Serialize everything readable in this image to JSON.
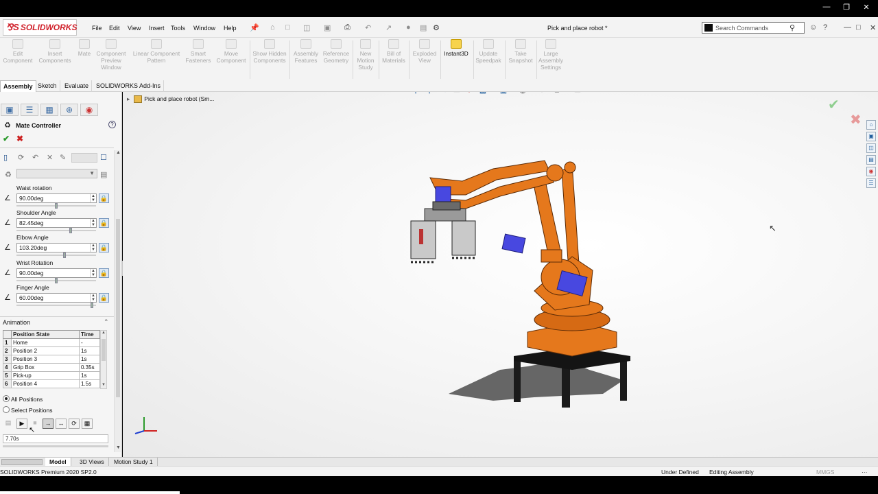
{
  "app": {
    "logo": "SOLIDWORKS",
    "document_title": "Pick and place robot *",
    "menus": [
      "File",
      "Edit",
      "View",
      "Insert",
      "Tools",
      "Window",
      "Help"
    ],
    "search_placeholder": "Search Commands"
  },
  "command_manager": {
    "buttons": [
      {
        "label": "Edit Component",
        "enabled": false
      },
      {
        "label": "Insert Components",
        "enabled": false
      },
      {
        "label": "Mate",
        "enabled": false
      },
      {
        "label": "Component Preview Window",
        "enabled": false
      },
      {
        "label": "Linear Component Pattern",
        "enabled": false
      },
      {
        "label": "Smart Fasteners",
        "enabled": false
      },
      {
        "label": "Move Component",
        "enabled": false
      },
      {
        "label": "Show Hidden Components",
        "enabled": false
      },
      {
        "label": "Assembly Features",
        "enabled": false
      },
      {
        "label": "Reference Geometry",
        "enabled": false
      },
      {
        "label": "New Motion Study",
        "enabled": false
      },
      {
        "label": "Bill of Materials",
        "enabled": false
      },
      {
        "label": "Exploded View",
        "enabled": false
      },
      {
        "label": "Instant3D",
        "enabled": true
      },
      {
        "label": "Update Speedpak",
        "enabled": false
      },
      {
        "label": "Take Snapshot",
        "enabled": false
      },
      {
        "label": "Large Assembly Settings",
        "enabled": false
      }
    ]
  },
  "tabs": [
    "Assembly",
    "Sketch",
    "Evaluate",
    "SOLIDWORKS Add-Ins"
  ],
  "active_tab": "Assembly",
  "panel": {
    "title": "Mate Controller",
    "mates": [
      {
        "label": "Waist rotation",
        "value": "90.00deg",
        "slider": 0.5
      },
      {
        "label": "Shoulder Angle",
        "value": "82.45deg",
        "slider": 0.69
      },
      {
        "label": "Elbow Angle",
        "value": "103.20deg",
        "slider": 0.61
      },
      {
        "label": "Wrist Rotation",
        "value": "90.00deg",
        "slider": 0.5
      },
      {
        "label": "Finger Angle",
        "value": "60.00deg",
        "slider": 0.96
      }
    ],
    "animation": {
      "header": "Animation",
      "columns": [
        "Position State",
        "Time"
      ],
      "rows": [
        {
          "n": "1",
          "state": "Home",
          "time": "-"
        },
        {
          "n": "2",
          "state": "Position 2",
          "time": "1s"
        },
        {
          "n": "3",
          "state": "Position 3",
          "time": "1s"
        },
        {
          "n": "4",
          "state": "Grip Box",
          "time": "0.35s"
        },
        {
          "n": "5",
          "state": "Pick-up",
          "time": "1s"
        },
        {
          "n": "6",
          "state": "Position 4",
          "time": "1.5s"
        }
      ],
      "radio_all": "All Positions",
      "radio_select": "Select Positions",
      "time_value": "7.70s"
    }
  },
  "tree": {
    "root_label": "Pick and place robot  (Sm..."
  },
  "bottom_tabs": [
    "Model",
    "3D Views",
    "Motion Study 1"
  ],
  "status": {
    "product": "SOLIDWORKS Premium 2020 SP2.0",
    "definition": "Under Defined",
    "mode": "Editing Assembly",
    "units": "MMGS"
  },
  "colors": {
    "robot_orange": "#e5781c",
    "motor_blue": "#4848e0",
    "stand_black": "#1a1a1a",
    "accent_red": "#d0202a"
  }
}
